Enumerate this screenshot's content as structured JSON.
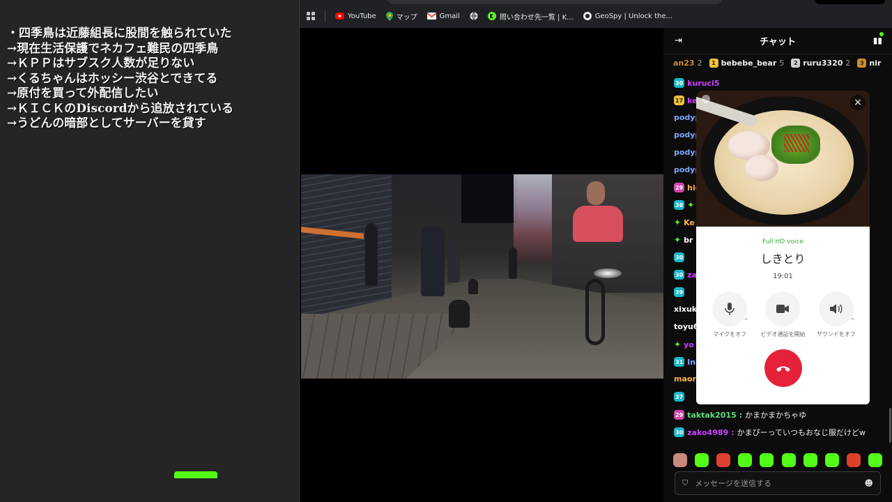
{
  "notes": {
    "lines": [
      "・四季鳥は近藤組長に股間を触られていた",
      "→現在生活保護でネカフェ難民の四季鳥",
      "→ＫＰＰはサブスク人数が足りない",
      "→くるちゃんはホッシー渋谷とできてる",
      "→原付を買って外配信したい",
      "→ＫＩＣＫのDiscordから追放されている",
      "→うどんの暗部としてサーバーを貸す"
    ]
  },
  "browser": {
    "bookmarks": [
      {
        "label": "YouTube",
        "icon": "youtube-icon",
        "color": "#ff0000"
      },
      {
        "label": "マップ",
        "icon": "maps-icon",
        "color": "#34a853"
      },
      {
        "label": "Gmail",
        "icon": "gmail-icon",
        "color": "#ea4335"
      },
      {
        "label": "",
        "icon": "globe-icon",
        "color": "#9aa0a6"
      },
      {
        "label": "問い合わせ先一覧 | K...",
        "icon": "kick-icon",
        "color": "#53fc18"
      },
      {
        "label": "GeoSpy | Unlock the...",
        "icon": "geospy-icon",
        "color": "#444444"
      }
    ]
  },
  "chat": {
    "title": "チャット",
    "leaders": [
      {
        "name": "an23",
        "count": "2",
        "rank": "",
        "color": "#d08a2a"
      },
      {
        "name": "bebebe_bear",
        "count": "5",
        "rank": "1",
        "color": "#f0c03a"
      },
      {
        "name": "ruru3320",
        "count": "2",
        "rank": "2",
        "color": "#d0d0d0"
      },
      {
        "name": "nir",
        "count": "",
        "rank": "3",
        "color": "#d08a2a"
      }
    ],
    "messages": [
      {
        "badge": "30",
        "badge_color": "teal",
        "spark": false,
        "user": "kuruci5",
        "user_color": "#c840ff",
        "text": ""
      },
      {
        "badge": "17",
        "badge_color": "gold",
        "spark": false,
        "user": "ke",
        "user_color": "#c840ff",
        "text": ""
      },
      {
        "badge": "",
        "badge_color": "",
        "spark": false,
        "user": "podyp",
        "user_color": "#7aa8ff",
        "text": ""
      },
      {
        "badge": "",
        "badge_color": "",
        "spark": false,
        "user": "podyp",
        "user_color": "#7aa8ff",
        "text": ""
      },
      {
        "badge": "",
        "badge_color": "",
        "spark": false,
        "user": "podyp",
        "user_color": "#7aa8ff",
        "text": ""
      },
      {
        "badge": "",
        "badge_color": "",
        "spark": false,
        "user": "podyp",
        "user_color": "#7aa8ff",
        "text": ""
      },
      {
        "badge": "29",
        "badge_color": "pink",
        "spark": false,
        "user": "hic",
        "user_color": "#ffb347",
        "text": ""
      },
      {
        "badge": "38",
        "badge_color": "teal",
        "spark": true,
        "user": "",
        "user_color": "#ffffff",
        "text": ""
      },
      {
        "badge": "",
        "badge_color": "",
        "spark": true,
        "user": "Ke",
        "user_color": "#ffb347",
        "text": ""
      },
      {
        "badge": "",
        "badge_color": "",
        "spark": true,
        "user": "br",
        "user_color": "#ffffff",
        "text": ""
      },
      {
        "badge": "30",
        "badge_color": "teal",
        "spark": false,
        "user": "",
        "user_color": "#ffffff",
        "text": ""
      },
      {
        "badge": "30",
        "badge_color": "teal",
        "spark": false,
        "user": "za",
        "user_color": "#c840ff",
        "text": ""
      },
      {
        "badge": "39",
        "badge_color": "teal",
        "spark": false,
        "user": "",
        "user_color": "#ffffff",
        "text": ""
      },
      {
        "badge": "",
        "badge_color": "",
        "spark": false,
        "user": "xixuki",
        "user_color": "#ffffff",
        "text": ""
      },
      {
        "badge": "",
        "badge_color": "",
        "spark": false,
        "user": "toyu6",
        "user_color": "#ffffff",
        "text": ""
      },
      {
        "badge": "",
        "badge_color": "",
        "spark": true,
        "user": "yo",
        "user_color": "#c840ff",
        "text": ""
      },
      {
        "badge": "31",
        "badge_color": "teal",
        "spark": false,
        "user": "Inc",
        "user_color": "#7aa8ff",
        "text": ""
      },
      {
        "badge": "",
        "badge_color": "",
        "spark": false,
        "user": "maori",
        "user_color": "#ffb347",
        "text": ""
      },
      {
        "badge": "37",
        "badge_color": "teal",
        "spark": false,
        "user": "",
        "user_color": "#ffffff",
        "text": ""
      },
      {
        "badge": "29",
        "badge_color": "pink",
        "spark": false,
        "user": "taktak2015",
        "user_color": "#5ee07a",
        "text": "かまかまかちゃゆ"
      },
      {
        "badge": "30",
        "badge_color": "teal",
        "spark": false,
        "user": "zako4989",
        "user_color": "#c840ff",
        "text": "かまぴーっていつもおなじ服だけどw"
      }
    ],
    "input_placeholder": "メッセージを送信する"
  },
  "call": {
    "quality": "Full HD voice",
    "caller_name": "しきとり",
    "duration": "19:01",
    "controls": [
      {
        "icon": "microphone-icon",
        "label": "マイクをオフ"
      },
      {
        "icon": "video-camera-icon",
        "label": "ビデオ通話を開始"
      },
      {
        "icon": "speaker-icon",
        "label": "サウンドをオフ"
      }
    ]
  }
}
